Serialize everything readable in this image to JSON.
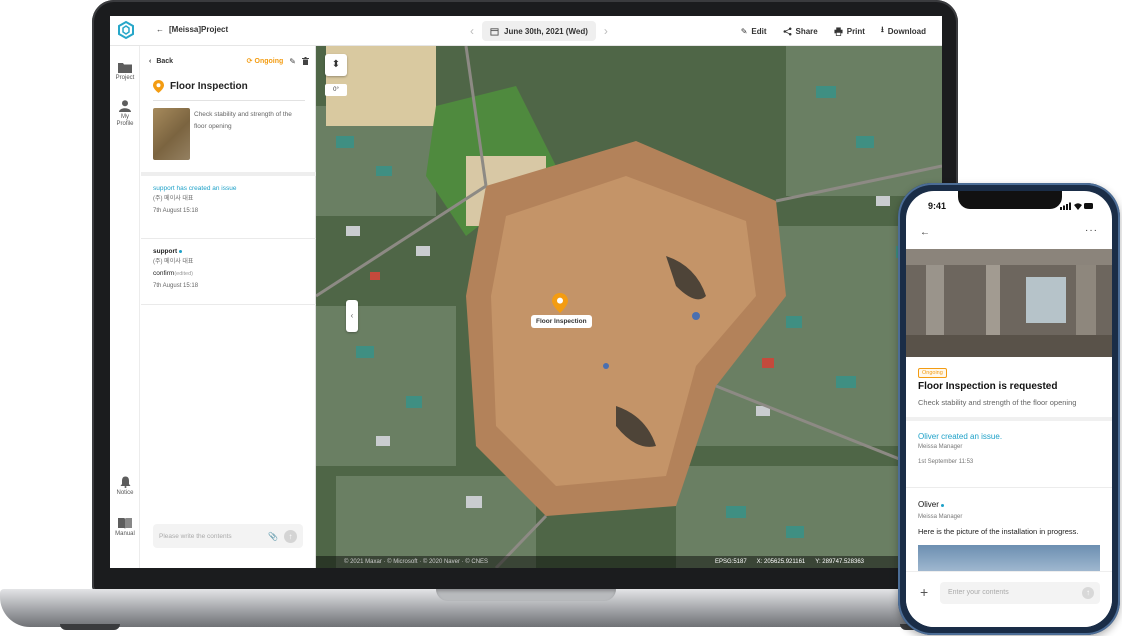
{
  "topbar": {
    "project_title": "[Meissa]Project",
    "date": "June 30th, 2021 (Wed)",
    "actions": {
      "edit": "Edit",
      "share": "Share",
      "print": "Print",
      "download": "Download"
    }
  },
  "sidebar": {
    "items": [
      {
        "label": "Project",
        "icon": "folder-icon"
      },
      {
        "label": "My Profile",
        "icon": "profile-icon"
      },
      {
        "label": "Notice",
        "icon": "bell-icon"
      },
      {
        "label": "Manual",
        "icon": "book-icon"
      }
    ]
  },
  "issue_panel": {
    "back_label": "Back",
    "status": "Ongoing",
    "title": "Floor Inspection",
    "description": "Check stability and strength of the floor opening",
    "activities": [
      {
        "headline": "support has created an issue",
        "company": "(주) 메이사  대표",
        "time": "7th August  15:18"
      },
      {
        "author": "support",
        "company": "(주) 메이사  대표",
        "text": "confirm",
        "edited": "(edited)",
        "time": "7th August  15:18"
      }
    ],
    "comment_placeholder": "Please write the contents"
  },
  "map": {
    "rotation": "0°",
    "marker_label": "Floor Inspection",
    "footer": {
      "copyright": "© 2021 Maxar · © Microsoft · © 2020 Naver · © CNES",
      "epsg": "EPSG:5187",
      "x": "X: 205625.921161",
      "y": "Y: 289747.528363"
    }
  },
  "phone": {
    "time": "9:41",
    "badge": "Ongoing",
    "title": "Floor Inspection is requested",
    "description": "Check stability and strength of the floor opening",
    "activities": [
      {
        "headline": "Oliver created an issue.",
        "meta": "Meissa   Manager",
        "time": "1st September   11:53"
      },
      {
        "author": "Oliver",
        "meta": "Meissa   Manager",
        "text": "Here is the picture of the installation in progress."
      }
    ],
    "input_placeholder": "Enter your contents"
  },
  "colors": {
    "accent": "#1ea1c8",
    "status": "#f39c12"
  }
}
